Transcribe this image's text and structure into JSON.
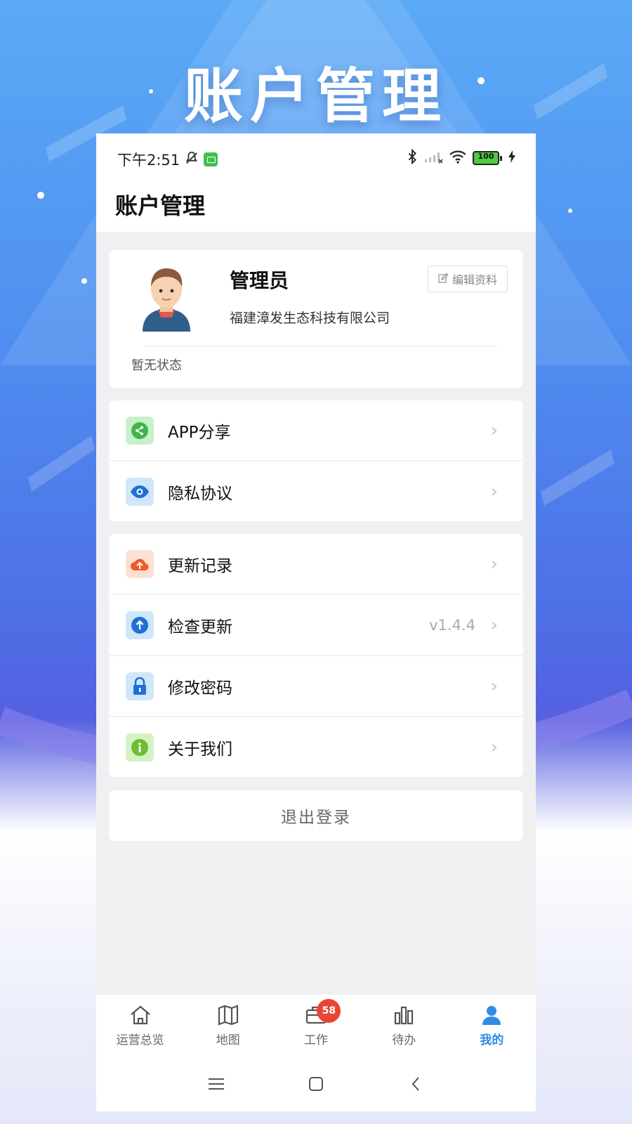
{
  "promo": {
    "title": "账户管理"
  },
  "status_bar": {
    "time": "下午2:51",
    "battery": "100"
  },
  "header": {
    "title": "账户管理"
  },
  "profile": {
    "name": "管理员",
    "company": "福建漳发生态科技有限公司",
    "edit_label": "编辑资料",
    "status": "暂无状态"
  },
  "menu_groups": [
    [
      {
        "label": "APP分享",
        "icon": "share-icon",
        "color": "#4cc15b"
      },
      {
        "label": "隐私协议",
        "icon": "eye-icon",
        "color": "#1f7be0"
      }
    ],
    [
      {
        "label": "更新记录",
        "icon": "cloud-upload-icon",
        "color": "#f26a3c"
      },
      {
        "label": "检查更新",
        "icon": "arrow-up-icon",
        "color": "#1f7be0",
        "value": "v1.4.4"
      },
      {
        "label": "修改密码",
        "icon": "lock-icon",
        "color": "#1f6fe0"
      },
      {
        "label": "关于我们",
        "icon": "info-icon",
        "color": "#74c23b"
      }
    ]
  ],
  "logout_label": "退出登录",
  "tabs": [
    {
      "label": "运营总览",
      "icon": "home-icon"
    },
    {
      "label": "地图",
      "icon": "map-icon"
    },
    {
      "label": "工作",
      "icon": "briefcase-icon",
      "badge": "58"
    },
    {
      "label": "待办",
      "icon": "bar-chart-icon"
    },
    {
      "label": "我的",
      "icon": "person-icon",
      "active": true
    }
  ],
  "colors": {
    "accent": "#2e8be8",
    "badge": "#e94535"
  }
}
